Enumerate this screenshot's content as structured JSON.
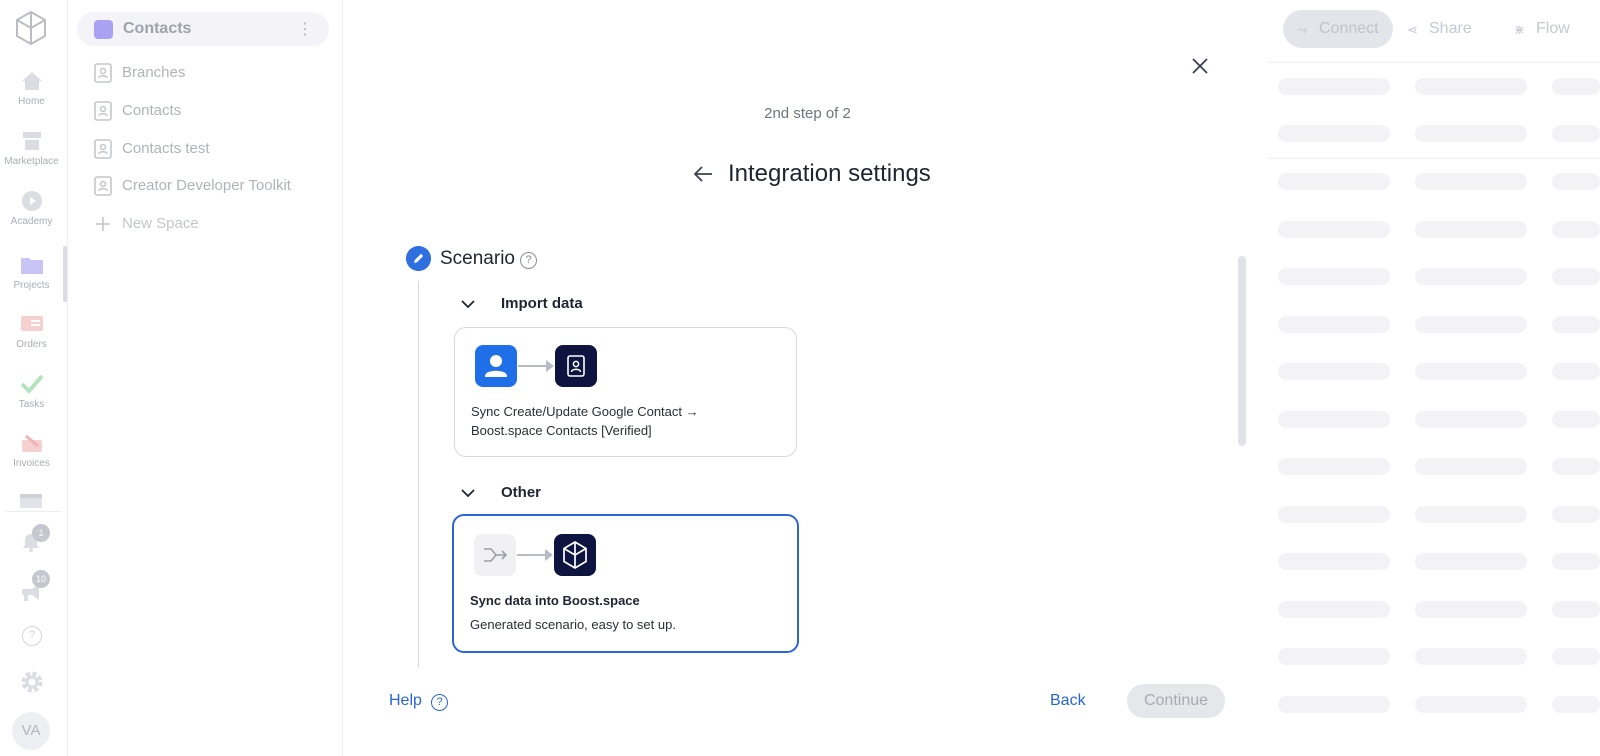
{
  "rail": {
    "items": [
      {
        "label": "Home"
      },
      {
        "label": "Marketplace"
      },
      {
        "label": "Academy"
      },
      {
        "label": "Projects"
      },
      {
        "label": "Orders"
      },
      {
        "label": "Tasks"
      },
      {
        "label": "Invoices"
      }
    ],
    "notifications_count": "1",
    "announcements_count": "10",
    "help_glyph": "?",
    "avatar_initials": "VA"
  },
  "sidebar": {
    "space_title": "Contacts",
    "menu_glyph": "⋮",
    "items": [
      {
        "label": "Branches"
      },
      {
        "label": "Contacts"
      },
      {
        "label": "Contacts test"
      },
      {
        "label": "Creator Developer Toolkit"
      }
    ],
    "new_space": "New Space"
  },
  "toolbar": {
    "connect": "Connect",
    "share": "Share",
    "flow": "Flow"
  },
  "modal": {
    "step": "2nd step of 2",
    "title": "Integration settings",
    "section": "Scenario",
    "help_glyph": "?",
    "groups": [
      {
        "label": "Import data",
        "card": {
          "text": "Sync Create/Update Google Contact →\nBoost.space Contacts [Verified]"
        }
      },
      {
        "label": "Other",
        "card": {
          "title": "Sync data into Boost.space",
          "text": "Generated scenario, easy to set up."
        }
      }
    ],
    "footer": {
      "help": "Help",
      "back": "Back",
      "continue": "Continue"
    }
  },
  "colors": {
    "accent": "#2b66d6",
    "selected_border": "#2b66d6",
    "dark_tile": "#0d1440",
    "google_contacts_blue": "#2f6fe0"
  }
}
